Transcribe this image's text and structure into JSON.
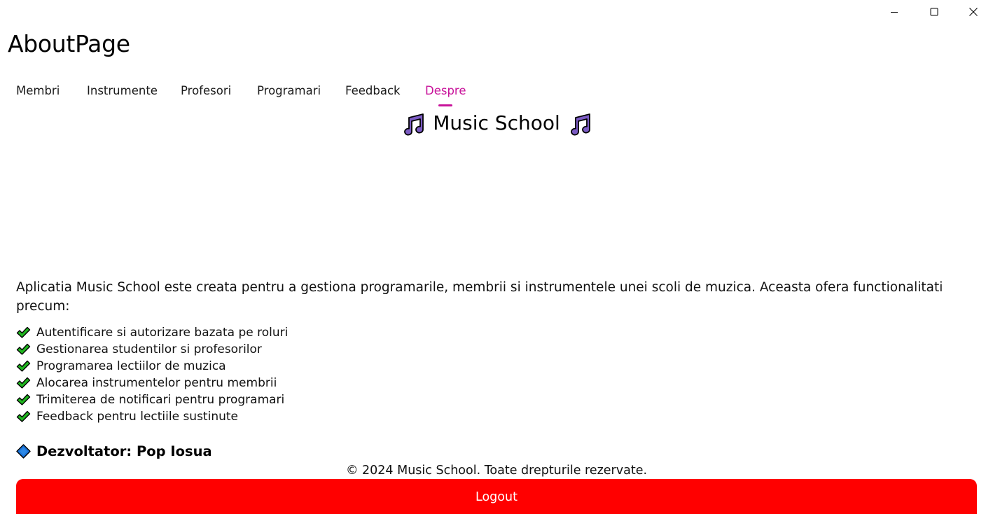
{
  "window": {
    "controls": {
      "minimize_icon": "minimize-icon",
      "maximize_icon": "maximize-icon",
      "close_icon": "close-icon"
    }
  },
  "page": {
    "title": "AboutPage"
  },
  "tabs": [
    {
      "label": "Membri",
      "selected": false
    },
    {
      "label": "Instrumente",
      "selected": false
    },
    {
      "label": "Profesori",
      "selected": false
    },
    {
      "label": "Programari",
      "selected": false
    },
    {
      "label": "Feedback",
      "selected": false
    },
    {
      "label": "Despre",
      "selected": true
    }
  ],
  "hero": {
    "title": "Music School",
    "icon": "musical-notes-icon"
  },
  "description": "Aplicatia Music School este creata pentru a gestiona programarile, membrii si instrumentele unei scoli de muzica. Aceasta ofera functionalitati precum:",
  "features": {
    "icon": "check-mark-icon",
    "items": [
      "Autentificare si autorizare bazata pe roluri",
      "Gestionarea studentilor si profesorilor",
      "Programarea lectiilor de muzica",
      "Alocarea instrumentelor pentru membrii",
      "Trimiterea de notificari pentru programari",
      "Feedback pentru lectiile sustinute"
    ]
  },
  "developer": {
    "icon": "blue-diamond-icon",
    "label": "Dezvoltator: Pop Iosua"
  },
  "footer": {
    "copyright": "© 2024 Music School. Toate drepturile rezervate."
  },
  "logout": {
    "label": "Logout"
  },
  "colors": {
    "accent": "#c8139a",
    "logout_background": "#ff0000",
    "note_fill": "#7c5cc4",
    "check_fill": "#1fb51f",
    "diamond_fill": "#1a73d9"
  }
}
